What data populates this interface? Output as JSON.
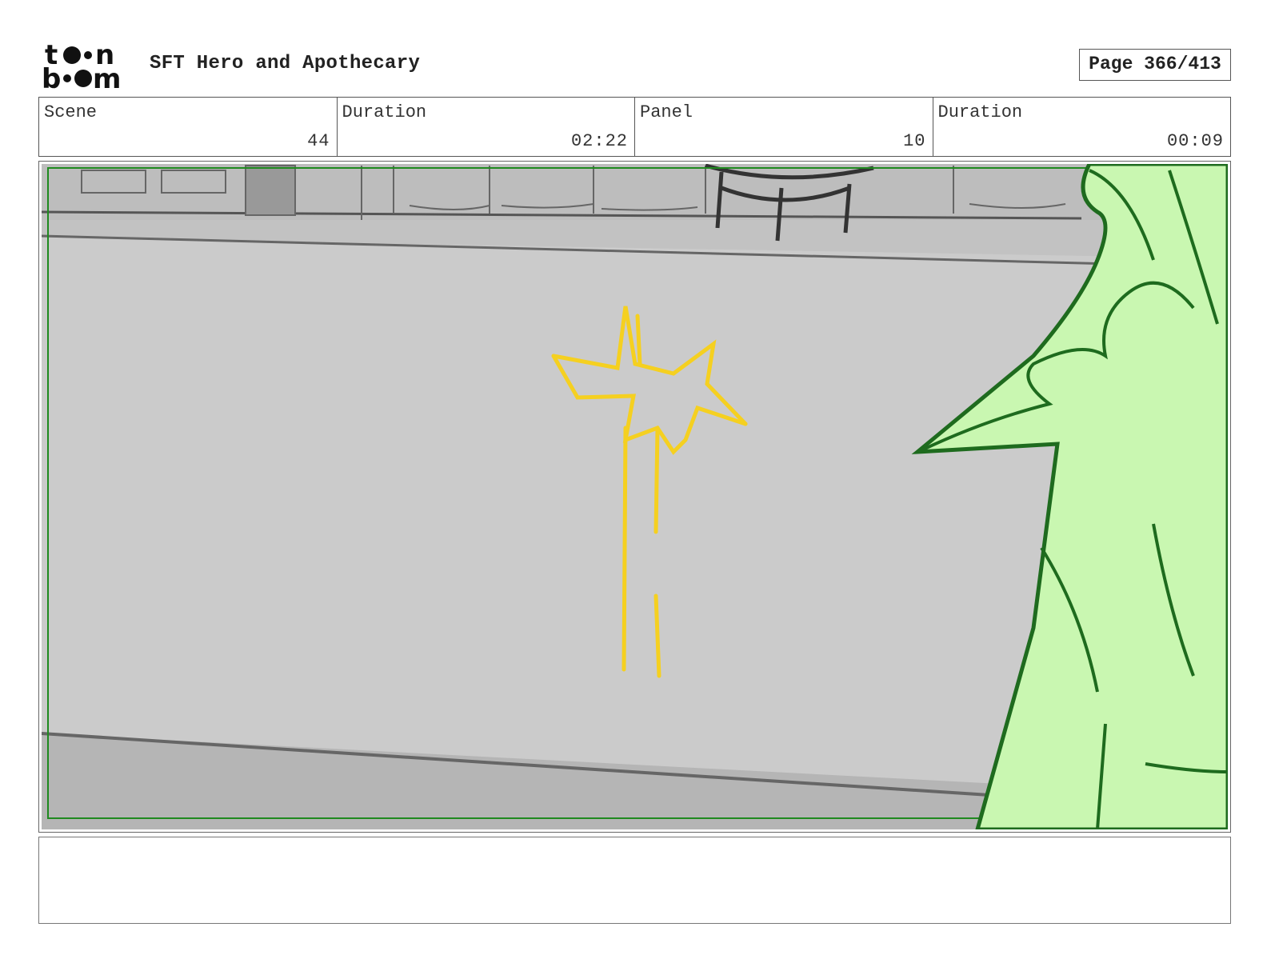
{
  "header": {
    "logo_text": "toon boom",
    "project_title": "SFT Hero and Apothecary",
    "page_label": "Page 366/413"
  },
  "info": {
    "scene_label": "Scene",
    "scene_value": "44",
    "scene_duration_label": "Duration",
    "scene_duration_value": "02:22",
    "panel_label": "Panel",
    "panel_value": "10",
    "panel_duration_label": "Duration",
    "panel_duration_value": "00:09"
  },
  "panel": {
    "image_alt": "storyboard-sketch",
    "colors": {
      "background_gray": "#cfcfcf",
      "sparkle_yellow": "#f5d020",
      "character_fill": "#c9f7b1",
      "character_line": "#1e6b1e",
      "safe_frame": "#1f8a1f"
    }
  },
  "notes": {
    "text": ""
  }
}
